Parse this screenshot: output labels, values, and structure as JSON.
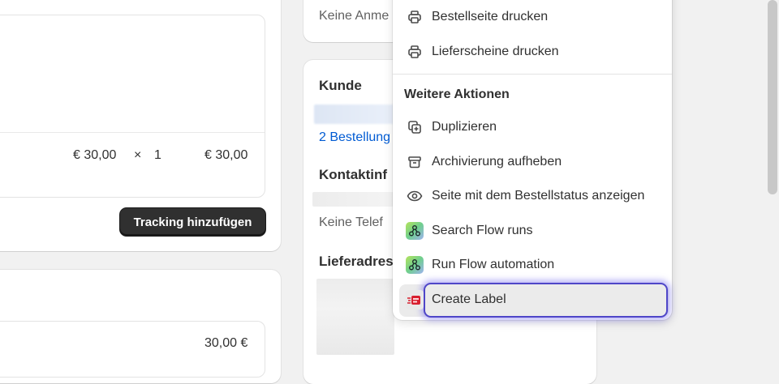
{
  "order": {
    "price": "€ 30,00",
    "times": "×",
    "quantity": "1",
    "total": "€ 30,00",
    "tracking_button": "Tracking hinzufügen",
    "payment_amount": "30,00 €"
  },
  "sidebar": {
    "notes_text": "Keine Anme",
    "customer_title": "Kunde",
    "orders_link": "2 Bestellung",
    "contact_title": "Kontaktinf",
    "no_phone": "Keine Telef",
    "shipping_title": "Lieferadres"
  },
  "menu": {
    "print_items": [
      {
        "label": "Bestellseite drucken",
        "icon": "printer-icon"
      },
      {
        "label": "Lieferscheine drucken",
        "icon": "printer-icon"
      }
    ],
    "heading": "Weitere Aktionen",
    "actions": [
      {
        "label": "Duplizieren",
        "icon": "duplicate-icon"
      },
      {
        "label": "Archivierung aufheben",
        "icon": "archive-icon"
      },
      {
        "label": "Seite mit dem Bestellstatus anzeigen",
        "icon": "eye-icon"
      },
      {
        "label": "Search Flow runs",
        "icon": "flow-app-icon"
      },
      {
        "label": "Run Flow automation",
        "icon": "flow-app-icon"
      },
      {
        "label": "Create Label",
        "icon": "label-app-icon"
      }
    ]
  },
  "colors": {
    "focus_ring": "#4f46c8",
    "link": "#005bd3",
    "primary_button": "#303030"
  }
}
